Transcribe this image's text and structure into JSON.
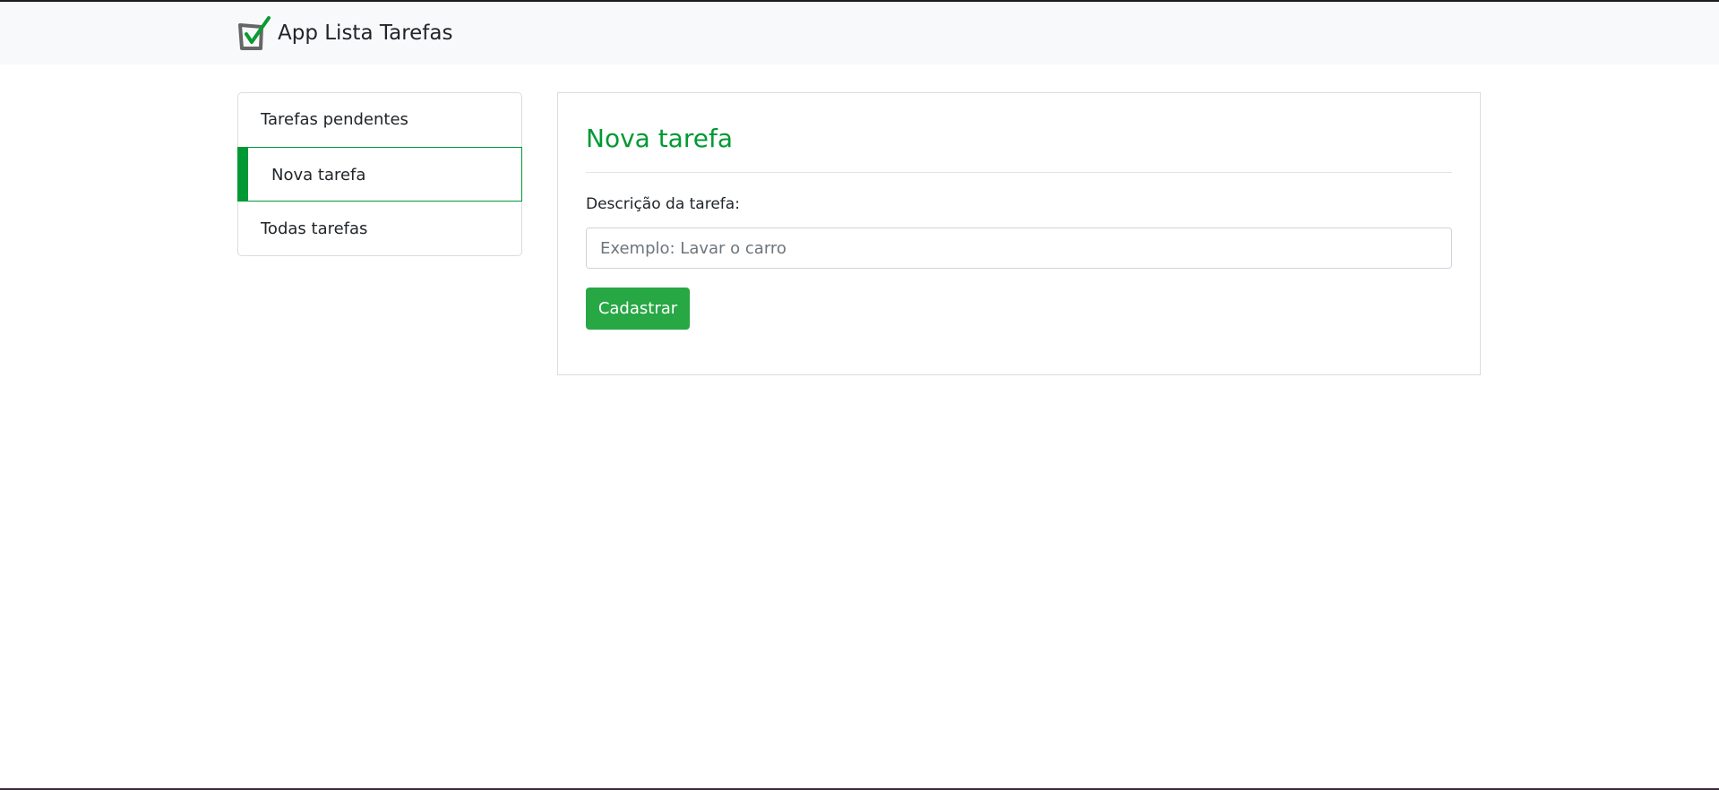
{
  "navbar": {
    "brand": "App Lista Tarefas",
    "logo_icon": "checkbox-check-icon"
  },
  "sidebar": {
    "items": [
      {
        "label": "Tarefas pendentes",
        "active": false
      },
      {
        "label": "Nova tarefa",
        "active": true
      },
      {
        "label": "Todas tarefas",
        "active": false
      }
    ]
  },
  "main": {
    "title": "Nova tarefa",
    "label": "Descrição da tarefa:",
    "input_value": "",
    "input_placeholder": "Exemplo: Lavar o carro",
    "submit_label": "Cadastrar"
  },
  "colors": {
    "accent": "#009933",
    "button": "#28a745",
    "navbar_bg": "#f8f9fa"
  }
}
